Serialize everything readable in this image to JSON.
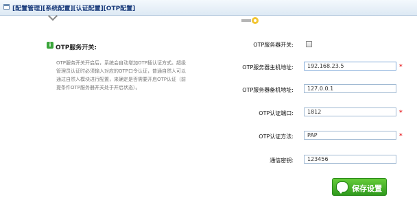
{
  "breadcrumb": "[配置管理][系统配置][认证配置][OTP配置]",
  "left": {
    "title": "OTP服务开关:",
    "description": "OTP服务开关开启后，系统会自动增加OTP插认证方式。超级管理员认证时必须输入对应的OTP口令认证，普通自然人可以通过自然人模块进行配置，来确定是否需要开启OTP认证（前提条件OTP服务器开关处于开启状态）。"
  },
  "form": {
    "switch_label": "OTP服务器开关:",
    "primary_label": "OTP服务器主机地址:",
    "primary_value": "192.168.23.5",
    "backup_label": "OTP服务器备机地址:",
    "backup_value": "127.0.0.1",
    "port_label": "OTP认证端口:",
    "port_value": "1812",
    "method_label": "OTP认证方法:",
    "method_value": "PAP",
    "secret_label": "通信密钥:",
    "secret_value": "123456"
  },
  "required_mark": "*",
  "save_label": "保存设置",
  "info_glyph": "i"
}
